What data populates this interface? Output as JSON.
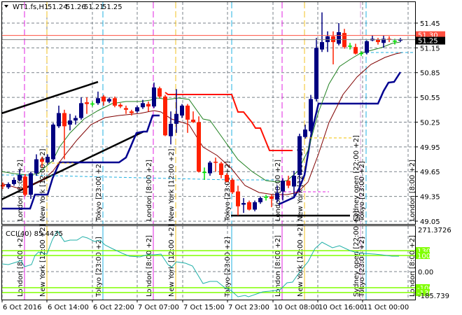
{
  "header": {
    "symbol": "WT1.fs,H1",
    "open": "51.24",
    "high": "51.26",
    "low": "51.21",
    "close": "51.25",
    "menu_icon": "triangle-down-icon"
  },
  "price_axis": {
    "ticks": [
      "51.45",
      "51.15",
      "50.85",
      "50.55",
      "50.25",
      "49.95",
      "49.65",
      "49.35",
      "49.05"
    ],
    "tick_values": [
      51.45,
      51.15,
      50.85,
      50.55,
      50.25,
      49.95,
      49.65,
      49.35,
      49.05
    ],
    "ask_label": "51.30",
    "ask_value": 51.3,
    "bid_label": "51.25",
    "bid_value": 51.25
  },
  "time_axis": {
    "labels": [
      "6 Oct 2016",
      "6 Oct 14:00",
      "6 Oct 22:00",
      "7 Oct 07:00",
      "7 Oct 15:00",
      "7 Oct 23:00",
      "10 Oct 08:00",
      "10 Oct 16:00",
      "11 Oct 00:00"
    ]
  },
  "sessions": [
    {
      "label": "London  [8:00  +2]",
      "color": "#e020e0"
    },
    {
      "label": "New York  [12:00  +2]",
      "color": "#f0c020"
    },
    {
      "label": "Tokyo  [23:00  +2]",
      "color": "#20b0e0"
    },
    {
      "label": "Sydney open  [22:00  +2]",
      "color": "#d8a0d8"
    }
  ],
  "cci": {
    "label": "CCI(40) 85.4435",
    "max_label": "271.3726",
    "min_label": "-185.739",
    "zero_label": "0.00",
    "levels": [
      "130",
      "100",
      "-100",
      "-130"
    ],
    "level_values": [
      130,
      100,
      -100,
      -130
    ],
    "level_color": "#80ff00"
  },
  "colors": {
    "bull": "#000080",
    "bear": "#ff2000",
    "doji": "#00e000",
    "ma_fast": "#208020",
    "ma_slow": "#800000",
    "ask_line": "#ff5040",
    "bid_line": "#808080"
  },
  "candles": [
    [
      49.49,
      49.52,
      49.44,
      49.47
    ],
    [
      49.46,
      49.52,
      49.44,
      49.5
    ],
    [
      49.5,
      49.58,
      49.48,
      49.55
    ],
    [
      49.55,
      49.67,
      49.53,
      49.61
    ],
    [
      49.59,
      49.62,
      49.35,
      49.37
    ],
    [
      49.37,
      49.65,
      49.32,
      49.63
    ],
    [
      49.63,
      49.86,
      49.6,
      49.8
    ],
    [
      49.8,
      49.83,
      49.7,
      49.77
    ],
    [
      49.76,
      49.86,
      49.74,
      49.83
    ],
    [
      49.8,
      50.24,
      49.77,
      50.22
    ],
    [
      50.2,
      50.45,
      50.18,
      50.36
    ],
    [
      50.36,
      50.4,
      49.8,
      50.2
    ],
    [
      50.22,
      50.35,
      50.15,
      50.27
    ],
    [
      50.27,
      50.33,
      50.22,
      50.3
    ],
    [
      50.3,
      50.55,
      50.28,
      50.48
    ],
    [
      50.49,
      50.55,
      50.35,
      50.47
    ],
    [
      50.47,
      50.5,
      50.44,
      50.47
    ],
    [
      50.48,
      50.62,
      50.46,
      50.54
    ],
    [
      50.56,
      50.58,
      50.45,
      50.5
    ],
    [
      50.5,
      50.55,
      50.48,
      50.53
    ],
    [
      50.54,
      50.56,
      50.43,
      50.45
    ],
    [
      50.46,
      50.48,
      50.42,
      50.44
    ],
    [
      50.42,
      50.45,
      50.35,
      50.4
    ],
    [
      50.38,
      50.4,
      50.33,
      50.36
    ],
    [
      50.38,
      50.45,
      50.36,
      50.43
    ],
    [
      50.43,
      50.52,
      50.41,
      50.48
    ],
    [
      50.47,
      50.5,
      50.38,
      50.44
    ],
    [
      50.44,
      50.73,
      50.42,
      50.67
    ],
    [
      50.66,
      50.68,
      50.54,
      50.56
    ],
    [
      50.56,
      50.58,
      50.08,
      50.09
    ],
    [
      50.08,
      50.38,
      49.98,
      50.23
    ],
    [
      50.23,
      50.65,
      50.12,
      50.35
    ],
    [
      50.33,
      50.47,
      50.3,
      50.45
    ],
    [
      50.45,
      50.47,
      50.12,
      50.28
    ],
    [
      50.28,
      50.38,
      50.24,
      50.25
    ],
    [
      50.25,
      50.32,
      49.64,
      49.65
    ],
    [
      49.64,
      49.7,
      49.55,
      49.64
    ],
    [
      49.63,
      49.78,
      49.6,
      49.76
    ],
    [
      49.77,
      49.82,
      49.65,
      49.76
    ],
    [
      49.75,
      49.77,
      49.57,
      49.61
    ],
    [
      49.61,
      49.63,
      49.52,
      49.53
    ],
    [
      49.55,
      49.57,
      49.38,
      49.4
    ],
    [
      49.41,
      49.48,
      49.12,
      49.23
    ],
    [
      49.25,
      49.33,
      49.15,
      49.27
    ],
    [
      49.28,
      49.3,
      49.18,
      49.19
    ],
    [
      49.19,
      49.3,
      49.17,
      49.28
    ],
    [
      49.28,
      49.35,
      49.26,
      49.33
    ],
    [
      49.34,
      49.37,
      49.3,
      49.34
    ],
    [
      49.35,
      49.37,
      49.22,
      49.32
    ],
    [
      49.31,
      49.48,
      49.28,
      49.39
    ],
    [
      49.41,
      49.57,
      49.3,
      49.54
    ],
    [
      49.54,
      49.6,
      49.45,
      49.48
    ],
    [
      49.47,
      49.66,
      49.35,
      49.6
    ],
    [
      49.61,
      50.11,
      49.4,
      50.08
    ],
    [
      50.07,
      50.22,
      50.05,
      50.16
    ],
    [
      50.14,
      50.58,
      50.12,
      50.53
    ],
    [
      50.53,
      51.27,
      50.5,
      51.15
    ],
    [
      51.13,
      51.58,
      51.1,
      51.22
    ],
    [
      51.22,
      51.35,
      51.1,
      51.29
    ],
    [
      51.29,
      51.35,
      50.95,
      51.22
    ],
    [
      51.2,
      51.45,
      51.18,
      51.34
    ],
    [
      51.33,
      51.38,
      51.14,
      51.16
    ],
    [
      51.17,
      51.21,
      51.13,
      51.17
    ],
    [
      51.16,
      51.2,
      51.07,
      51.08
    ],
    [
      51.08,
      51.11,
      51.05,
      51.08
    ],
    [
      51.09,
      51.24,
      51.07,
      51.23
    ],
    [
      51.24,
      51.3,
      51.23,
      51.26
    ],
    [
      51.25,
      51.27,
      51.19,
      51.22
    ],
    [
      51.21,
      51.3,
      51.15,
      51.26
    ],
    [
      51.26,
      51.29,
      51.22,
      51.25
    ],
    [
      51.23,
      51.26,
      51.19,
      51.23
    ],
    [
      51.24,
      51.27,
      51.22,
      51.25
    ]
  ]
}
